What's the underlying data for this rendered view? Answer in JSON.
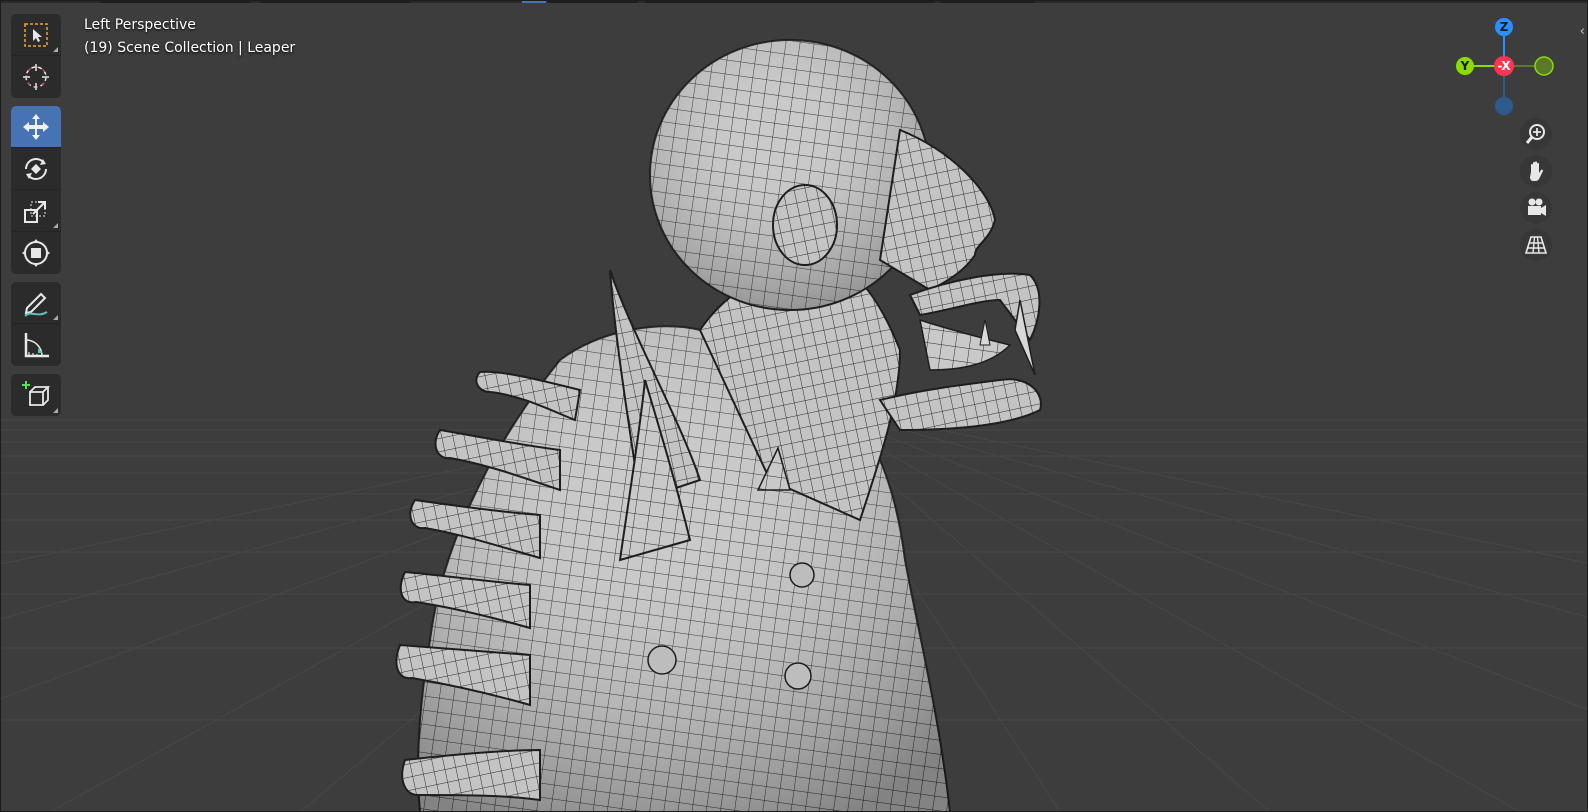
{
  "viewport": {
    "view_name": "Left Perspective",
    "collection_info": "(19) Scene Collection | Leaper"
  },
  "toolbar": {
    "tools": [
      {
        "name": "select-box",
        "active": false
      },
      {
        "name": "cursor",
        "active": false
      },
      {
        "name": "move",
        "active": true
      },
      {
        "name": "rotate",
        "active": false
      },
      {
        "name": "scale",
        "active": false
      },
      {
        "name": "transform",
        "active": false
      },
      {
        "name": "annotate",
        "active": false
      },
      {
        "name": "measure",
        "active": false
      },
      {
        "name": "add-cube",
        "active": false
      }
    ]
  },
  "gizmo": {
    "z_label": "Z",
    "y_label": "Y",
    "x_label": "-X",
    "colors": {
      "x": "#ff3352",
      "y": "#8bdc00",
      "z": "#2890ff"
    }
  },
  "nav_icons": [
    "zoom-icon",
    "hand-pan-icon",
    "camera-icon",
    "grid-view-icon"
  ],
  "edge_arrow": "‹",
  "colors": {
    "background": "#3d3d3d",
    "accent": "#4772b3",
    "mesh": "#cfcfcf"
  }
}
